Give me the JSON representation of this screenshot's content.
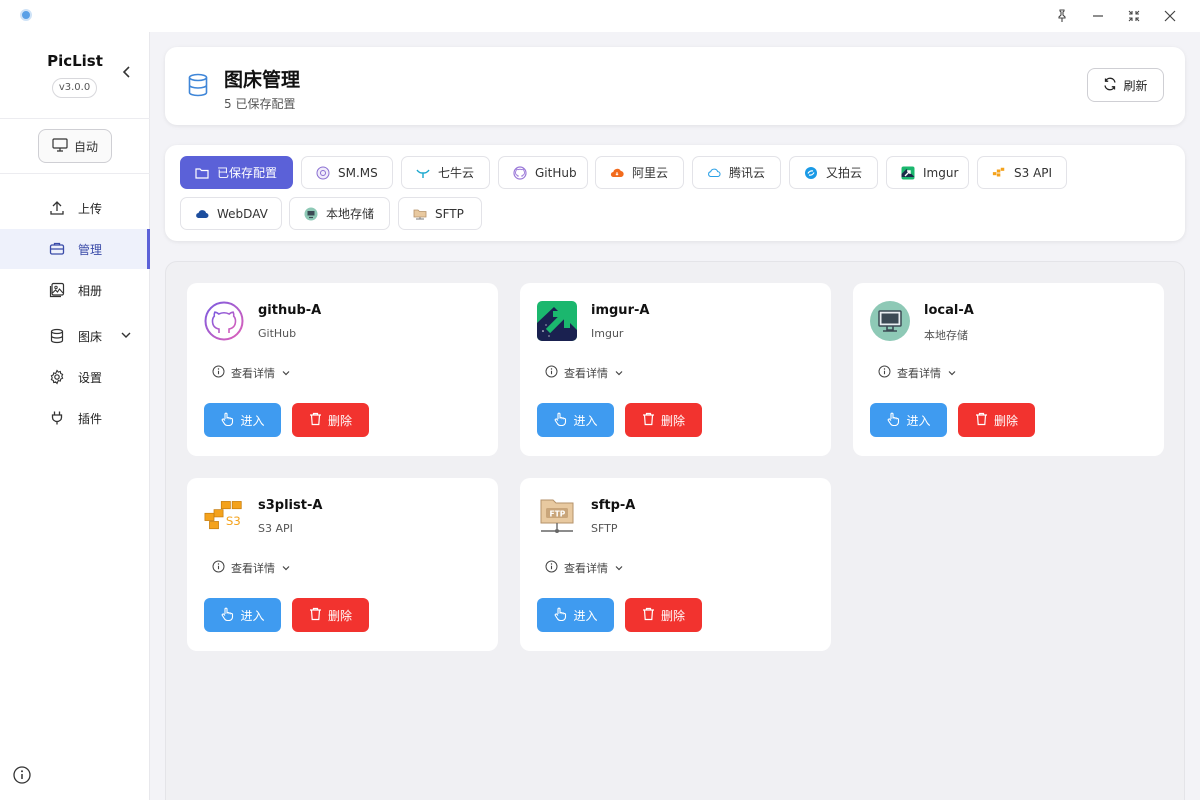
{
  "sidebar": {
    "brand": "PicList",
    "version": "v3.0.0",
    "auto_label": "自动",
    "items": [
      {
        "label": "上传",
        "icon": "upload-icon"
      },
      {
        "label": "管理",
        "icon": "briefcase-icon",
        "active": true
      },
      {
        "label": "相册",
        "icon": "gallery-icon"
      },
      {
        "label": "图床",
        "icon": "database-icon",
        "has_caret": true
      },
      {
        "label": "设置",
        "icon": "gear-icon"
      },
      {
        "label": "插件",
        "icon": "plug-icon"
      }
    ]
  },
  "header": {
    "title": "图床管理",
    "subtitle": "5 已保存配置",
    "refresh_label": "刷新"
  },
  "tabs": [
    {
      "label": "已保存配置",
      "active": true
    },
    {
      "label": "SM.MS"
    },
    {
      "label": "七牛云"
    },
    {
      "label": "GitHub"
    },
    {
      "label": "阿里云"
    },
    {
      "label": "腾讯云"
    },
    {
      "label": "又拍云"
    },
    {
      "label": "Imgur"
    },
    {
      "label": "S3 API"
    },
    {
      "label": "WebDAV"
    },
    {
      "label": "本地存储"
    },
    {
      "label": "SFTP"
    }
  ],
  "configs": [
    {
      "name": "github-A",
      "type": "GitHub"
    },
    {
      "name": "imgur-A",
      "type": "Imgur"
    },
    {
      "name": "local-A",
      "type": "本地存储"
    },
    {
      "name": "s3plist-A",
      "type": "S3 API"
    },
    {
      "name": "sftp-A",
      "type": "SFTP"
    }
  ],
  "card_labels": {
    "details": "查看详情",
    "enter": "进入",
    "delete": "删除"
  },
  "logo_text": {
    "s3": "S3",
    "ftp": "FTP"
  },
  "colors": {
    "accent": "#5b61d8",
    "enter": "#3f9bf0",
    "delete": "#f2332f"
  }
}
